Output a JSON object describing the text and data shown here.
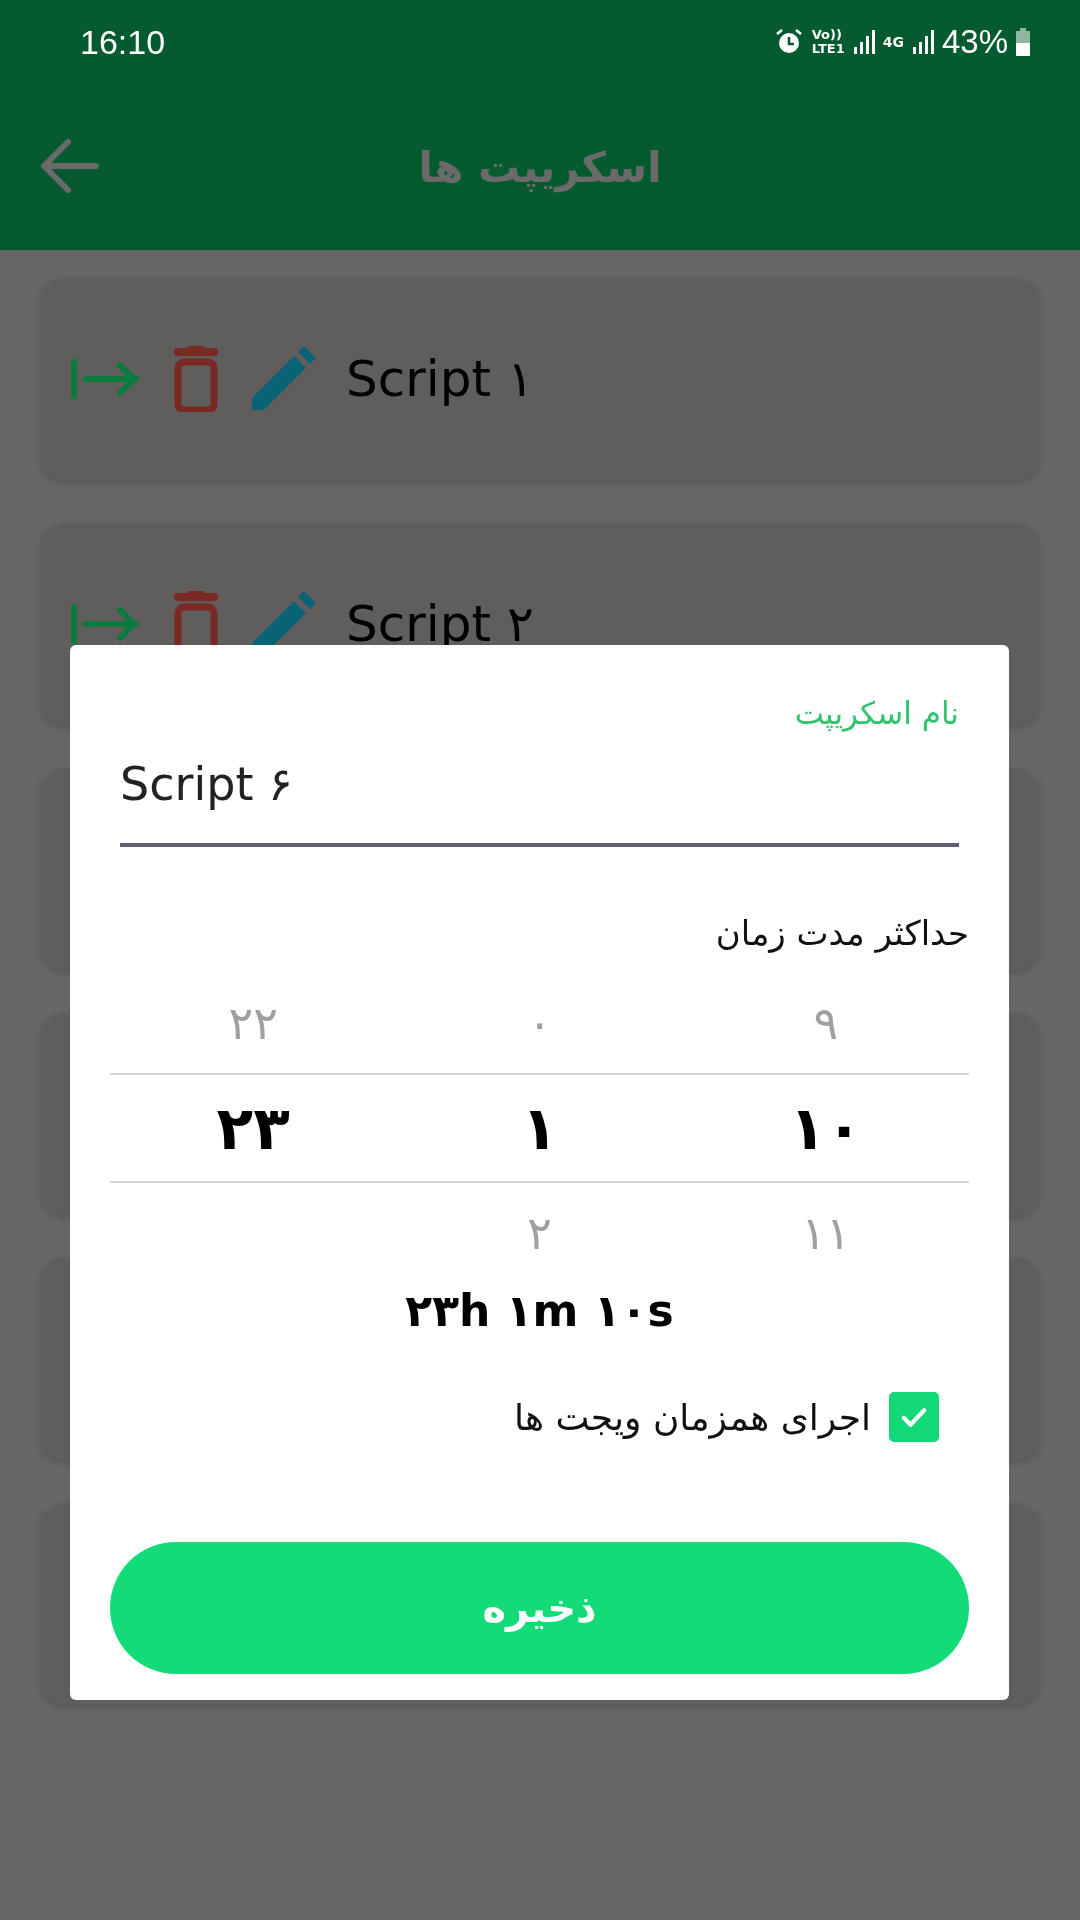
{
  "status_bar": {
    "time": "16:10",
    "volte": "Vo))",
    "lte": "LTE1",
    "network": "4G",
    "battery": "43%"
  },
  "app_bar": {
    "title": "اسکریپت ها"
  },
  "scripts": [
    {
      "name": "Script ۱"
    },
    {
      "name": "Script ۲"
    }
  ],
  "dialog": {
    "name_field": {
      "label": "نام اسکریپت",
      "value": "Script ۶"
    },
    "duration_label": "حداکثر مدت زمان",
    "picker": {
      "columns": [
        {
          "above": "۹",
          "value": "۱۰",
          "below": "۱۱"
        },
        {
          "above": "۰",
          "value": "۱",
          "below": "۲"
        },
        {
          "above": "۲۲",
          "value": "۲۳"
        }
      ]
    },
    "summary": "۲۳h ۱m ۱۰s",
    "concurrent": {
      "label": "اجرای همزمان ویجت ها",
      "checked": true
    },
    "save_button": "ذخیره"
  }
}
